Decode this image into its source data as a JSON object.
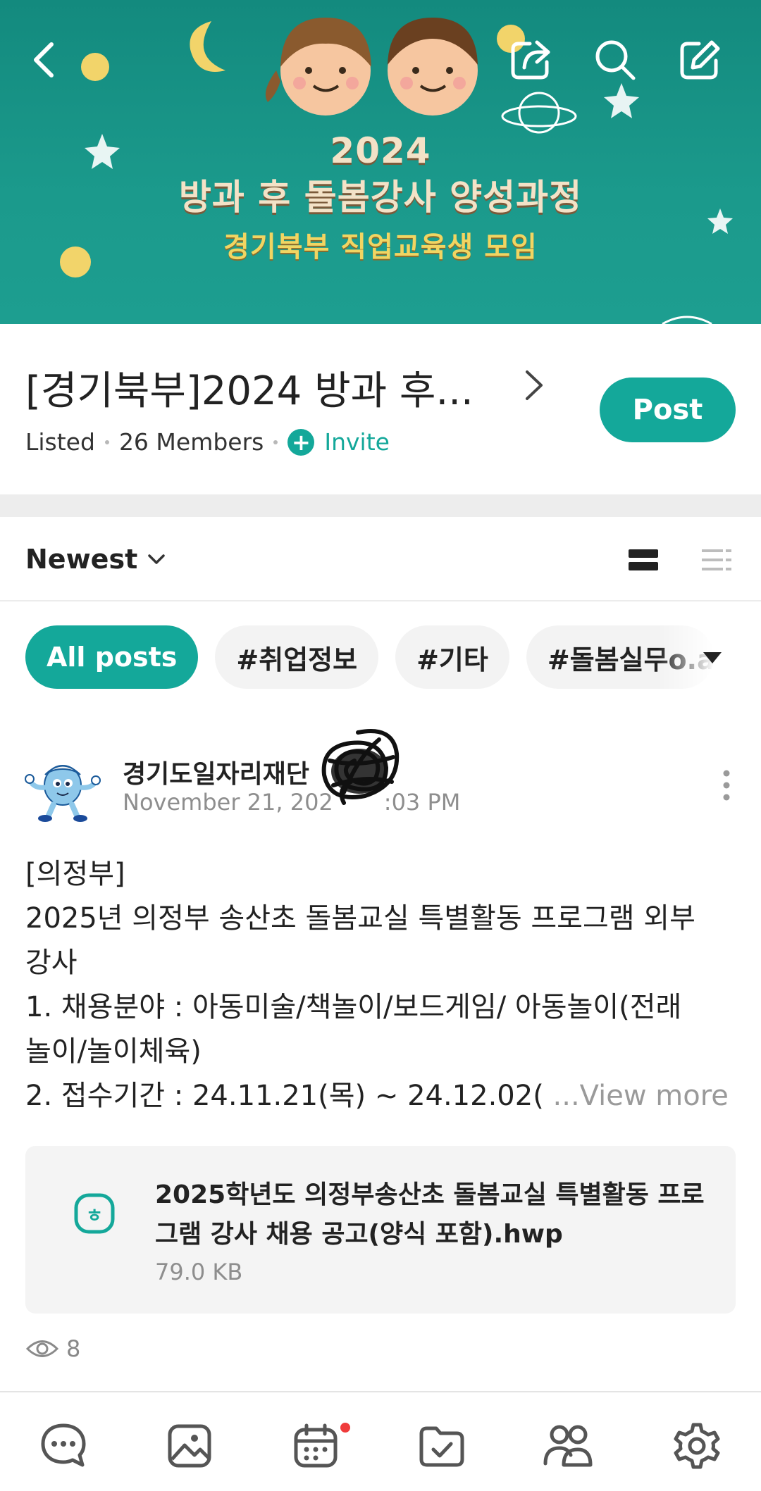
{
  "banner": {
    "year": "2024",
    "title": "방과 후 돌봄강사 양성과정",
    "subtitle": "경기북부 직업교육생 모임"
  },
  "group": {
    "name": "[경기북부]2024 방과 후...",
    "visibility": "Listed",
    "members": "26 Members",
    "invite_label": "Invite",
    "post_button": "Post"
  },
  "sort": {
    "label": "Newest"
  },
  "filters": [
    "All posts",
    "#취업정보",
    "#기타",
    "#돌봄실무o.a"
  ],
  "post": {
    "author": "경기도일자리재단",
    "date": "November 21, 202",
    "date_tail": ":03 PM",
    "body_lines": [
      "[의정부]",
      "2025년 의정부 송산초 돌봄교실 특별활동 프로그램 외부",
      "강사",
      "1. 채용분야 : 아동미술/책놀이/보드게임/ 아동놀이(전래",
      "놀이/놀이체육)",
      "2. 접수기간 : 24.11.21(목) ~ 24.12.02( "
    ],
    "view_more": "...View more",
    "attachment": {
      "name": "2025학년도 의정부송산초 돌봄교실 특별활동 프로그램 강사 채용 공고(양식 포함).hwp",
      "size": "79.0 KB"
    },
    "views": "8"
  },
  "colors": {
    "accent": "#14a89a",
    "banner_bg": "#1b9a8c",
    "notification_dot": "#ef3b3b"
  },
  "icons": {
    "top_bar": [
      "back-icon",
      "share-icon",
      "search-icon",
      "edit-icon"
    ],
    "bottom_nav": [
      "chat-icon",
      "photo-icon",
      "calendar-icon",
      "folder-icon",
      "members-icon",
      "settings-icon"
    ]
  }
}
